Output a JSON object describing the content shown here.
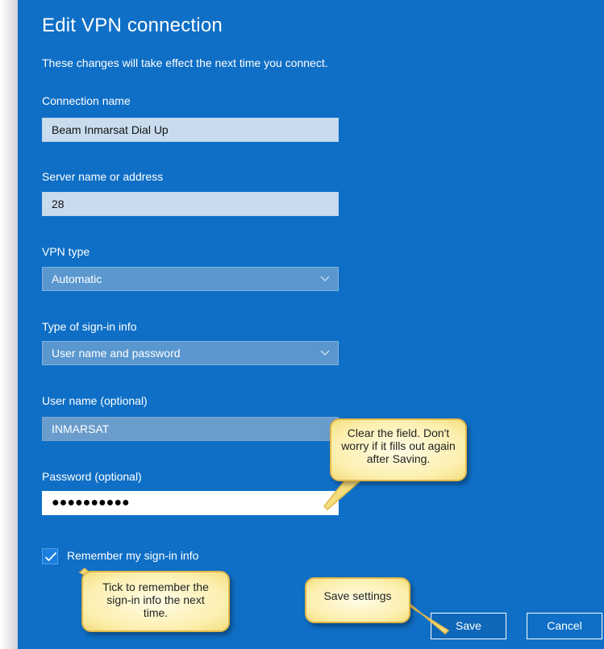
{
  "dialog": {
    "title": "Edit VPN connection",
    "subtitle": "These changes will take effect the next time you connect."
  },
  "fields": {
    "connection_name": {
      "label": "Connection name",
      "value": "Beam Inmarsat Dial Up"
    },
    "server": {
      "label": "Server name or address",
      "value": "28"
    },
    "vpn_type": {
      "label": "VPN type",
      "value": "Automatic"
    },
    "sign_in_type": {
      "label": "Type of sign-in info",
      "value": "User name and password"
    },
    "user_name": {
      "label": "User name (optional)",
      "value": "INMARSAT"
    },
    "password": {
      "label": "Password (optional)",
      "value": "●●●●●●●●●●"
    }
  },
  "remember": {
    "label": "Remember my sign-in info",
    "checked": true
  },
  "buttons": {
    "save": "Save",
    "cancel": "Cancel"
  },
  "callouts": {
    "clear_field": [
      "Clear the field.  Don't",
      "worry if it fills out again",
      "after Saving."
    ],
    "remember_tick": [
      "Tick to remember the",
      "sign-in info the next",
      "time."
    ],
    "save_settings": [
      "Save settings"
    ]
  },
  "colors": {
    "dialog_background": "#0f6fc6",
    "callout_fill": "#fcefae",
    "callout_border": "#e0b84a"
  },
  "icons": [
    "chevron-down-icon",
    "checkmark-icon"
  ]
}
